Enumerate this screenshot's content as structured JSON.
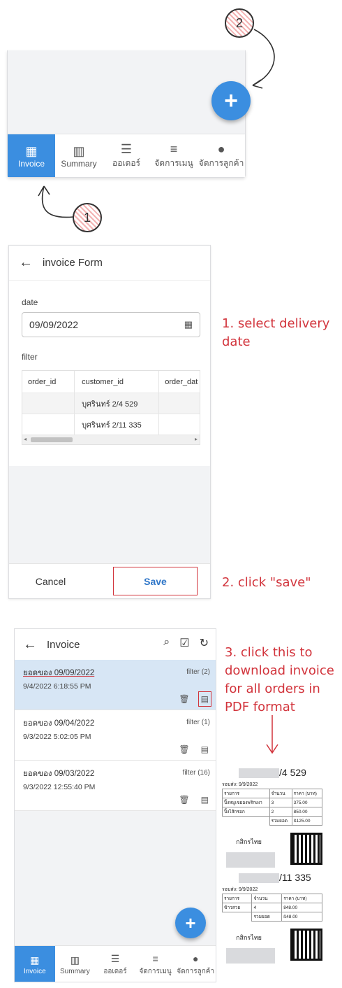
{
  "annotations": {
    "step1_num": "1",
    "step2_num": "2",
    "note1": "1. select delivery date",
    "note2": "2. click \"save\"",
    "note3": "3. click this to download invoice for all orders in PDF format"
  },
  "screen1": {
    "fab_label": "+",
    "nav": [
      {
        "label": "Invoice",
        "icon": "calendar-icon"
      },
      {
        "label": "Summary",
        "icon": "chart-icon"
      },
      {
        "label": "ออเดอร์",
        "icon": "burger-icon"
      },
      {
        "label": "จัดการเมนู",
        "icon": "menu-icon"
      },
      {
        "label": "จัดการลูกค้า",
        "icon": "person-icon"
      }
    ]
  },
  "screen2": {
    "title": "invoice Form",
    "date_label": "date",
    "date_value": "09/09/2022",
    "filter_label": "filter",
    "columns": [
      "order_id",
      "customer_id",
      "order_dat"
    ],
    "rows": [
      [
        "",
        "บุศรินทร์ 2/4 529",
        ""
      ],
      [
        "",
        "บุศรินทร์ 2/11 335",
        ""
      ]
    ],
    "cancel_label": "Cancel",
    "save_label": "Save"
  },
  "screen3": {
    "title": "Invoice",
    "invoices": [
      {
        "title": "ยอดของ 09/09/2022",
        "created": "9/4/2022 6:18:55 PM",
        "filter": "filter (2)"
      },
      {
        "title": "ยอดของ 09/04/2022",
        "created": "9/3/2022 5:02:05 PM",
        "filter": "filter (1)"
      },
      {
        "title": "ยอดของ 09/03/2022",
        "created": "9/3/2022 12:55:40 PM",
        "filter": "filter (16)"
      }
    ],
    "fab_label": "+",
    "nav": [
      {
        "label": "Invoice"
      },
      {
        "label": "Summary"
      },
      {
        "label": "ออเดอร์"
      },
      {
        "label": "จัดการเมนู"
      },
      {
        "label": "จัดการลูกค้า"
      }
    ]
  },
  "receipts": [
    {
      "title": "/4 529",
      "delivery": "รอบส่ง: 9/9/2022",
      "headers": [
        "รายการ",
        "จำนวน",
        "ราคา (บาท)"
      ],
      "items": [
        [
          "ปิ้งหมูเขยองพริกเผา",
          "3",
          "375.00"
        ],
        [
          "ปิ้งไส้กรอก",
          "2",
          "850.00"
        ]
      ],
      "total_label": "รวมยอด",
      "total": "ß125.00",
      "bank": "กสิกรไทย"
    },
    {
      "title": "/11 335",
      "delivery": "รอบส่ง: 9/9/2022",
      "headers": [
        "รายการ",
        "จำนวน",
        "ราคา (บาท)"
      ],
      "items": [
        [
          "ข้าวสวย",
          "4",
          "848.00"
        ]
      ],
      "total_label": "รวมยอด",
      "total": "ß48.00",
      "bank": "กสิกรไทย"
    }
  ]
}
